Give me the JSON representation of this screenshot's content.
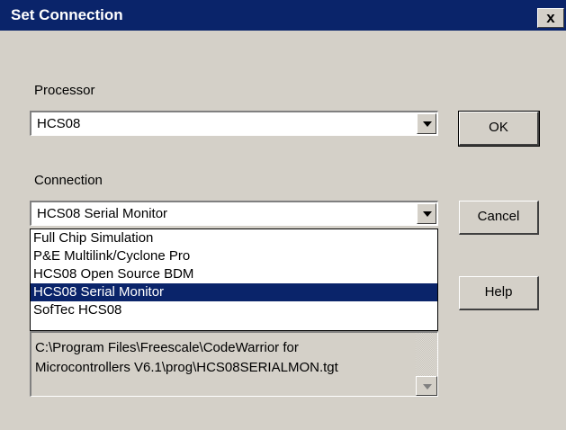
{
  "window": {
    "title": "Set Connection",
    "close_label": "x"
  },
  "processor": {
    "label": "Processor",
    "value": "HCS08"
  },
  "connection": {
    "label": "Connection",
    "value": "HCS08 Serial Monitor",
    "options": [
      "Full Chip Simulation",
      "P&E Multilink/Cyclone Pro",
      "HCS08 Open Source BDM",
      "HCS08 Serial Monitor",
      "SofTec HCS08"
    ],
    "selected_index": 3
  },
  "buttons": {
    "ok": "OK",
    "cancel": "Cancel",
    "help": "Help"
  },
  "target_path": "C:\\Program Files\\Freescale\\CodeWarrior for\nMicrocontrollers V6.1\\prog\\HCS08SERIALMON.tgt",
  "colors": {
    "title_bar": "#0a246a",
    "selection": "#0a246a",
    "dialog_bg": "#d4d0c8"
  }
}
